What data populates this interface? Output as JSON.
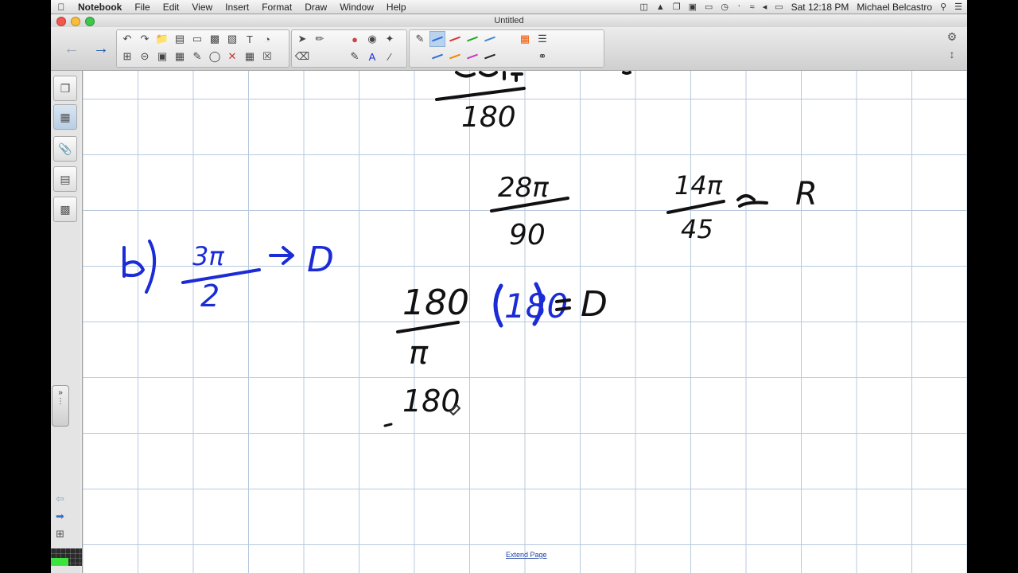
{
  "menubar": {
    "app": "Notebook",
    "items": [
      "File",
      "Edit",
      "View",
      "Insert",
      "Format",
      "Draw",
      "Window",
      "Help"
    ],
    "clock": "Sat 12:18 PM",
    "user": "Michael Belcastro"
  },
  "window": {
    "title": "Untitled"
  },
  "canvas": {
    "extend_link": "Extend Page",
    "ink_color_blue": "#1b2bd6",
    "ink_color_black": "#111111",
    "math_labels": [
      "28π",
      "90",
      "14π",
      "45",
      "R",
      "3π",
      "2",
      "D",
      "180",
      "π",
      "180",
      "D",
      "180"
    ]
  },
  "colors": {
    "grid": "#b8c9de",
    "selected_tool": "#b9d3ee",
    "meter": "#3de33d"
  }
}
